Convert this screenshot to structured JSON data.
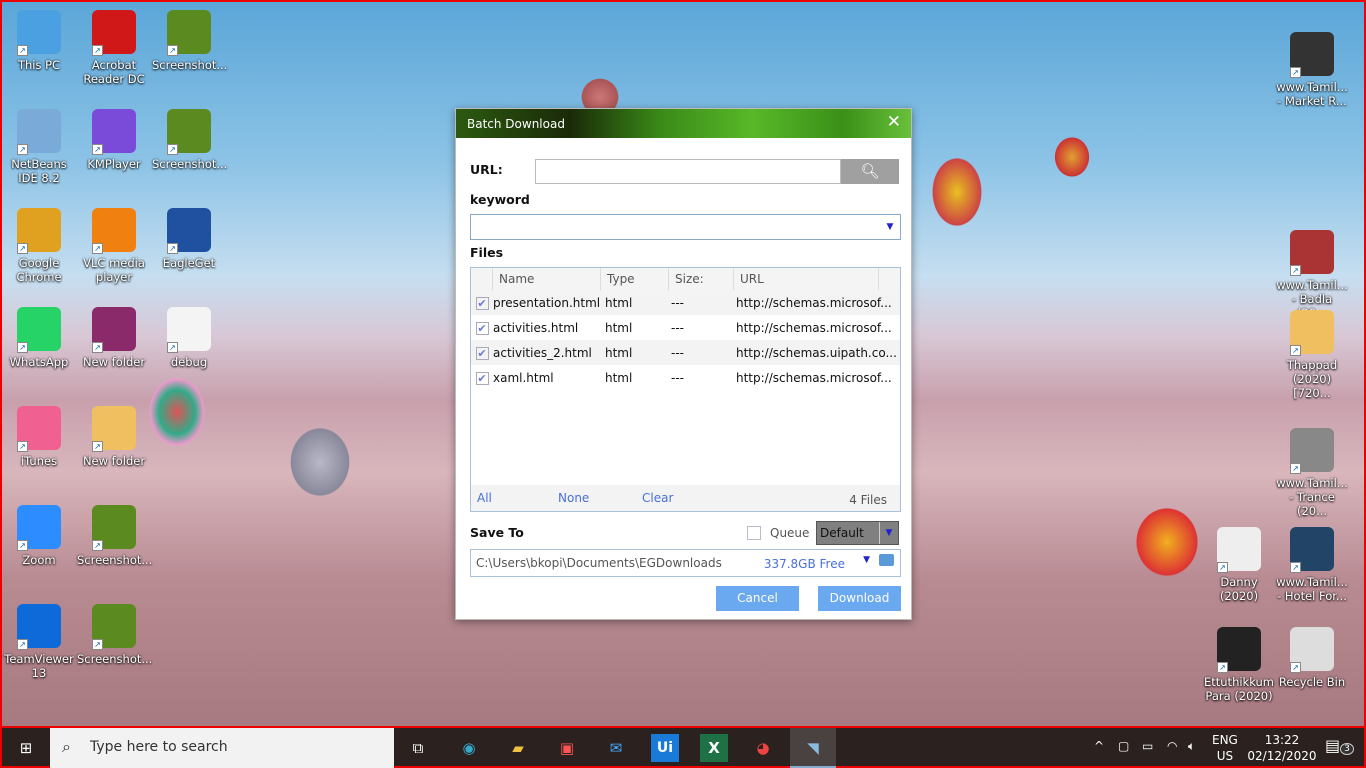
{
  "desktop": {
    "left": [
      {
        "label": "This PC",
        "icon": "computer-icon",
        "color": "#4aa0e0"
      },
      {
        "label": "Acrobat Reader DC",
        "icon": "acrobat-icon",
        "color": "#d01818"
      },
      {
        "label": "Screenshot...",
        "icon": "image-file-icon",
        "color": "#5a8a20"
      },
      {
        "label": "NetBeans IDE 8.2",
        "icon": "netbeans-icon",
        "color": "#7aaad8"
      },
      {
        "label": "KMPlayer",
        "icon": "kmplayer-icon",
        "color": "#7a4ad8"
      },
      {
        "label": "Screenshot...",
        "icon": "image-file-icon",
        "color": "#5a8a20"
      },
      {
        "label": "Google Chrome",
        "icon": "chrome-icon",
        "color": "#e0a020"
      },
      {
        "label": "VLC media player",
        "icon": "vlc-icon",
        "color": "#f08010"
      },
      {
        "label": "EagleGet",
        "icon": "eagleget-icon",
        "color": "#2050a0"
      },
      {
        "label": "WhatsApp",
        "icon": "whatsapp-icon",
        "color": "#25d366"
      },
      {
        "label": "New folder",
        "icon": "winrar-icon",
        "color": "#8a2a6a"
      },
      {
        "label": "debug",
        "icon": "text-file-icon",
        "color": "#f4f4f4"
      },
      {
        "label": "iTunes",
        "icon": "itunes-icon",
        "color": "#f06090"
      },
      {
        "label": "New folder",
        "icon": "folder-icon",
        "color": "#f0c060"
      },
      {
        "label": "Zoom",
        "icon": "zoom-icon",
        "color": "#2d8cff"
      },
      {
        "label": "Screenshot...",
        "icon": "image-file-icon",
        "color": "#5a8a20"
      },
      {
        "label": "TeamViewer 13",
        "icon": "teamviewer-icon",
        "color": "#0e6ad8"
      },
      {
        "label": "Screenshot...",
        "icon": "image-file-icon",
        "color": "#5a8a20"
      }
    ],
    "right": [
      {
        "label": "www.Tamil... - Market R...",
        "icon": "video-file-icon",
        "color": "#333"
      },
      {
        "label": "www.Tamil... - Badla (20...",
        "icon": "video-file-icon",
        "color": "#a33"
      },
      {
        "label": "Thappad (2020) [720...",
        "icon": "folder-icon",
        "color": "#f0c060"
      },
      {
        "label": "www.Tamil... - Trance (20...",
        "icon": "video-file-icon",
        "color": "#888"
      },
      {
        "label": "Danny (2020)",
        "icon": "video-file-icon",
        "color": "#eee"
      },
      {
        "label": "www.Tamil... - Hotel For...",
        "icon": "video-file-icon",
        "color": "#246"
      },
      {
        "label": "Ettuthikkum Para (2020)",
        "icon": "video-file-icon",
        "color": "#222"
      },
      {
        "label": "Recycle Bin",
        "icon": "recycle-bin-icon",
        "color": "#ddd"
      }
    ]
  },
  "dialog": {
    "title": "Batch Download",
    "url_label": "URL:",
    "url_value": "",
    "keyword_label": "keyword",
    "keyword_value": "",
    "files_label": "Files",
    "columns": [
      "Name",
      "Type",
      "Size:",
      "URL"
    ],
    "rows": [
      {
        "checked": true,
        "name": "presentation.html",
        "type": "html",
        "size": "---",
        "url": "http://schemas.microsof..."
      },
      {
        "checked": true,
        "name": "activities.html",
        "type": "html",
        "size": "---",
        "url": "http://schemas.microsof..."
      },
      {
        "checked": true,
        "name": "activities_2.html",
        "type": "html",
        "size": "---",
        "url": "http://schemas.uipath.co..."
      },
      {
        "checked": true,
        "name": "xaml.html",
        "type": "html",
        "size": "---",
        "url": "http://schemas.microsof..."
      }
    ],
    "all": "All",
    "none": "None",
    "clear": "Clear",
    "count": "4 Files",
    "save_to_label": "Save To",
    "queue_label": "Queue",
    "queue_checked": false,
    "category": "Default",
    "path": "C:\\Users\\bkopi\\Documents\\EGDownloads",
    "free": "337.8GB Free",
    "cancel": "Cancel",
    "download": "Download"
  },
  "taskbar": {
    "search_placeholder": "Type here to search",
    "apps": [
      "task-view",
      "edge",
      "file-explorer",
      "store",
      "mail",
      "uipath",
      "excel",
      "chrome",
      "eagleget"
    ],
    "uipath_label": "Ui",
    "lang_top": "ENG",
    "lang_bottom": "US",
    "time": "13:22",
    "date": "02/12/2020",
    "notifications": "3"
  }
}
